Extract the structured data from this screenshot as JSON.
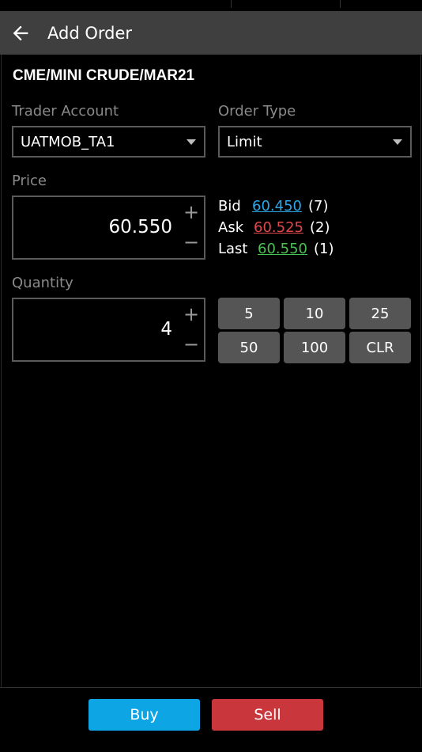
{
  "header": {
    "title": "Add Order",
    "back_icon": "arrow-left-icon"
  },
  "contract": "CME/MINI CRUDE/MAR21",
  "trader_account": {
    "label": "Trader Account",
    "value": "UATMOB_TA1"
  },
  "order_type": {
    "label": "Order Type",
    "value": "Limit"
  },
  "price": {
    "label": "Price",
    "value": "60.550",
    "plus": "+",
    "minus": "−"
  },
  "quotes": {
    "bid": {
      "label": "Bid",
      "price": "60.450",
      "qty": "(7)"
    },
    "ask": {
      "label": "Ask",
      "price": "60.525",
      "qty": "(2)"
    },
    "last": {
      "label": "Last",
      "price": "60.550",
      "qty": "(1)"
    }
  },
  "quantity": {
    "label": "Quantity",
    "value": "4",
    "plus": "+",
    "minus": "−",
    "presets": [
      "5",
      "10",
      "25",
      "50",
      "100",
      "CLR"
    ]
  },
  "actions": {
    "buy": "Buy",
    "sell": "Sell"
  },
  "colors": {
    "bid": "#2aa7e8",
    "ask": "#e0474c",
    "last": "#4cbf55",
    "buy_button": "#0ea5e4",
    "sell_button": "#c9373d",
    "appbar": "#3f3f3f",
    "preset_button": "#555555"
  }
}
